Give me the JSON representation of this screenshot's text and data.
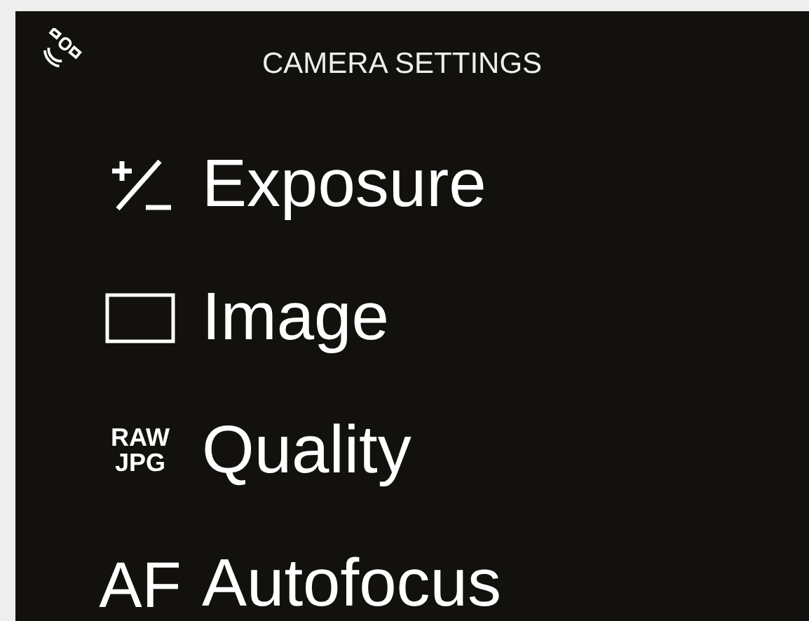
{
  "header": {
    "title": "CAMERA SETTINGS"
  },
  "menu": [
    {
      "kind": "exposure",
      "label": "Exposure"
    },
    {
      "kind": "frame",
      "label": "Image"
    },
    {
      "kind": "text",
      "icon_text": [
        "RAW",
        "JPG"
      ],
      "label": "Quality"
    },
    {
      "kind": "text",
      "icon_text": [
        "AF"
      ],
      "label": "Autofocus"
    }
  ]
}
